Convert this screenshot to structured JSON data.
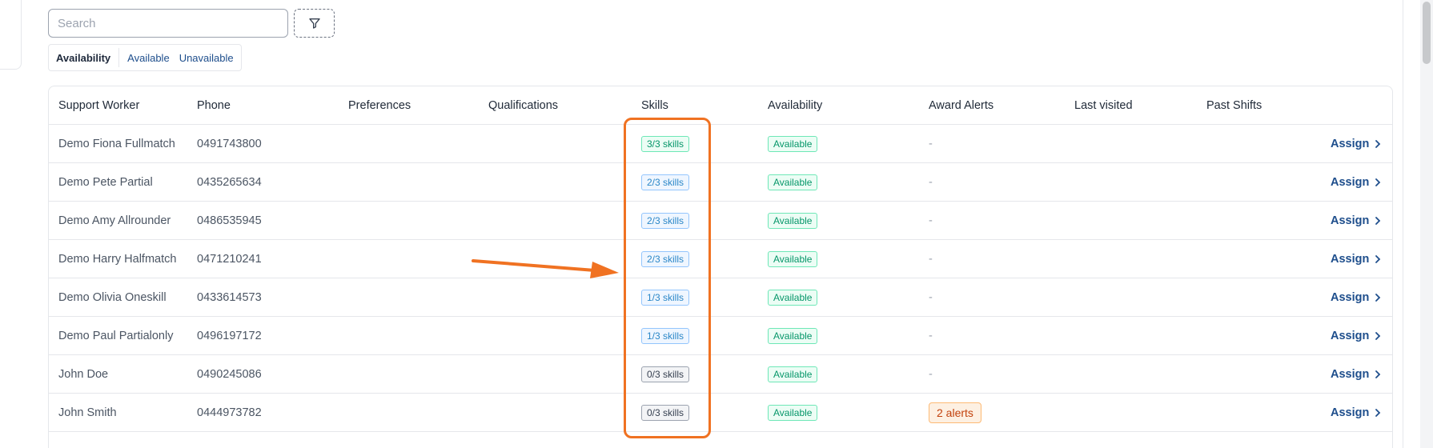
{
  "search": {
    "placeholder": "Search",
    "value": ""
  },
  "filter_icon": "filter-icon",
  "availability_filter": {
    "label": "Availability",
    "options": [
      "Available",
      "Unavailable"
    ]
  },
  "table": {
    "columns": [
      "Support Worker",
      "Phone",
      "Preferences",
      "Qualifications",
      "Skills",
      "Availability",
      "Award Alerts",
      "Last visited",
      "Past Shifts"
    ],
    "assign_label": "Assign",
    "rows": [
      {
        "name": "Demo Fiona Fullmatch",
        "phone": "0491743800",
        "skills": "3/3 skills",
        "skills_level": "full",
        "availability": "Available",
        "award_alerts": "-"
      },
      {
        "name": "Demo Pete Partial",
        "phone": "0435265634",
        "skills": "2/3 skills",
        "skills_level": "partial",
        "availability": "Available",
        "award_alerts": "-"
      },
      {
        "name": "Demo Amy Allrounder",
        "phone": "0486535945",
        "skills": "2/3 skills",
        "skills_level": "partial",
        "availability": "Available",
        "award_alerts": "-"
      },
      {
        "name": "Demo Harry Halfmatch",
        "phone": "0471210241",
        "skills": "2/3 skills",
        "skills_level": "partial",
        "availability": "Available",
        "award_alerts": "-"
      },
      {
        "name": "Demo Olivia Oneskill",
        "phone": "0433614573",
        "skills": "1/3 skills",
        "skills_level": "partial",
        "availability": "Available",
        "award_alerts": "-"
      },
      {
        "name": "Demo Paul Partialonly",
        "phone": "0496197172",
        "skills": "1/3 skills",
        "skills_level": "partial",
        "availability": "Available",
        "award_alerts": "-"
      },
      {
        "name": "John Doe",
        "phone": "0490245086",
        "skills": "0/3 skills",
        "skills_level": "none",
        "availability": "Available",
        "award_alerts": "-"
      },
      {
        "name": "John Smith",
        "phone": "0444973782",
        "skills": "0/3 skills",
        "skills_level": "none",
        "availability": "Available",
        "award_alerts": "2 alerts"
      }
    ]
  },
  "colors": {
    "annotation": "#f07222",
    "link": "#1e4e8c",
    "green": "#059669",
    "blue": "#2b87c8"
  }
}
